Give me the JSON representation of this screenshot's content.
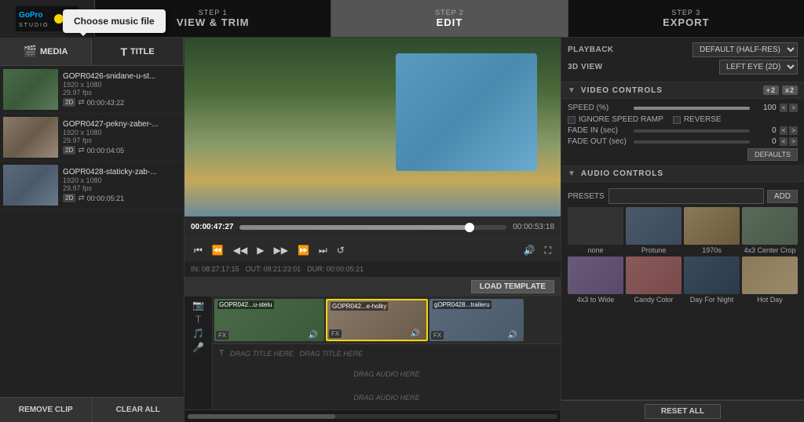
{
  "app": {
    "title": "GoPro Studio"
  },
  "steps": [
    {
      "num": "STEP 1",
      "label": "VIEW & TRIM",
      "active": false
    },
    {
      "num": "STEP 2",
      "label": "EDIT",
      "active": true
    },
    {
      "num": "STEP 3",
      "label": "EXPORT",
      "active": false
    }
  ],
  "left_panel": {
    "tabs": [
      {
        "label": "MEDIA",
        "active": true
      },
      {
        "label": "TITLE",
        "active": false
      }
    ],
    "media_items": [
      {
        "name": "GOPR0426-snidane-u-st...",
        "res": "1920 x 1080",
        "fps": "29.97 fps",
        "dur": "00:00:43:22"
      },
      {
        "name": "GOPR0427-pekny-zaber-...",
        "res": "1920 x 1080",
        "fps": "29.97 fps",
        "dur": "00:00:04:05"
      },
      {
        "name": "GOPR0428-staticky-zab-...",
        "res": "1920 x 1080",
        "fps": "29.97 fps",
        "dur": "00:00:05:21"
      }
    ],
    "btn_remove": "REMOVE CLIP",
    "btn_clear": "CLEAR ALL"
  },
  "tooltip": "Choose music file",
  "video": {
    "time_current": "00:00:47:27",
    "time_total": "00:00:53:18",
    "info_in": "IN: 08:27:17:15",
    "info_out": "OUT: 08:21:23:01",
    "info_dur": "DUR: 00:00:05:21"
  },
  "load_template": "LOAD TEMPLATE",
  "timeline": {
    "clips": [
      {
        "label": "GOPR042...u-stelu",
        "fx": "FX"
      },
      {
        "label": "GOPR042...e-holky",
        "fx": "FX"
      },
      {
        "label": "gOPR0428...traileru",
        "fx": "FX"
      }
    ],
    "title_placeholders": [
      "DRAG TITLE HERE",
      "DRAG TITLE HERE"
    ],
    "audio_placeholders": [
      "DRAG AUDIO HERE",
      "DRAG AUDIO HERE"
    ]
  },
  "right_panel": {
    "playback_label": "PLAYBACK",
    "playback_value": "DEFAULT (HALF-RES)",
    "view3d_label": "3D VIEW",
    "view3d_value": "LEFT EYE (2D)",
    "video_controls": {
      "title": "VIDEO CONTROLS",
      "badges": [
        "+2",
        "x2"
      ],
      "speed_label": "SPEED (%)",
      "speed_value": "100",
      "ignore_speed_ramp": "IGNORE SPEED RAMP",
      "reverse": "REVERSE",
      "fade_in_label": "FADE IN (sec)",
      "fade_in_value": "0",
      "fade_out_label": "FADE OUT (sec)",
      "fade_out_value": "0",
      "defaults_btn": "DEFAULTS"
    },
    "audio_controls": {
      "title": "AUDIO CONTROLS",
      "presets_label": "PRESETS",
      "add_btn": "ADD",
      "presets": [
        {
          "name": "none",
          "style": "pt-none"
        },
        {
          "name": "Protune",
          "style": "pt-protune"
        },
        {
          "name": "1970s",
          "style": "pt-1970s"
        },
        {
          "name": "4x3 Center Crop",
          "style": "pt-center"
        },
        {
          "name": "4x3 to Wide",
          "style": "pt-wide"
        },
        {
          "name": "Candy Color",
          "style": "pt-candy"
        },
        {
          "name": "Day For Night",
          "style": "pt-night"
        },
        {
          "name": "Hot Day",
          "style": "pt-hotday"
        }
      ]
    },
    "reset_all_btn": "RESET ALL"
  }
}
